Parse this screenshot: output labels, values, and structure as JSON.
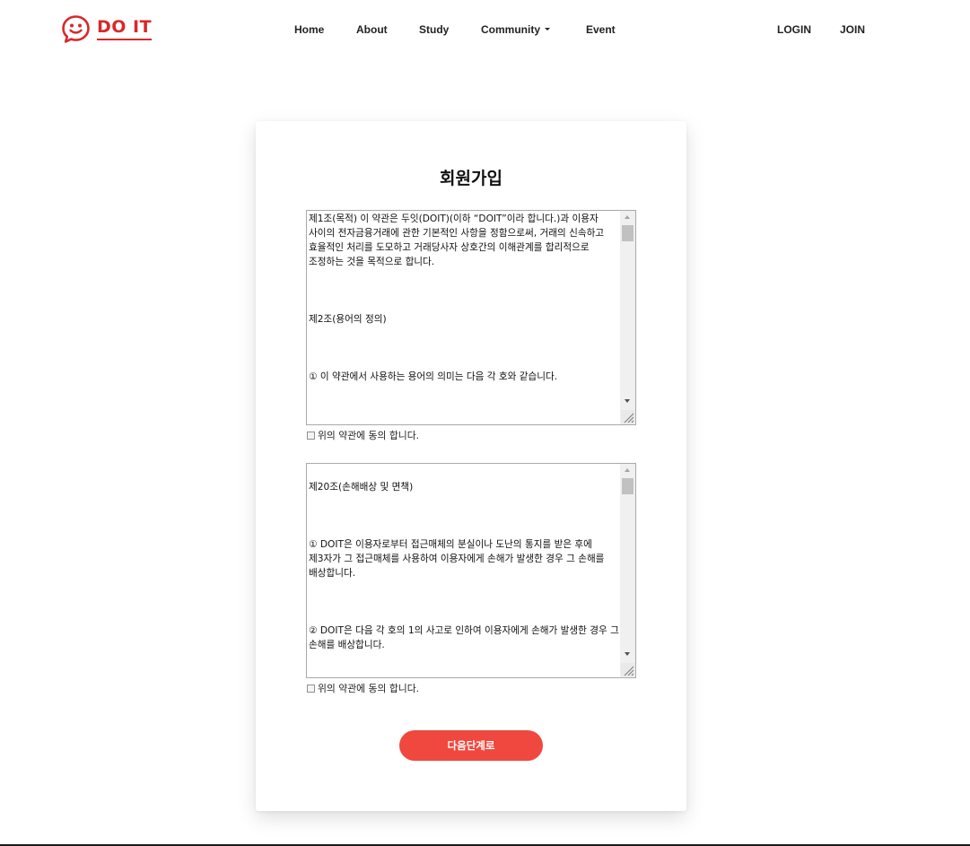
{
  "brand": {
    "name": "DO IT",
    "color": "#d8292b"
  },
  "nav": {
    "home": "Home",
    "about": "About",
    "study": "Study",
    "community": "Community",
    "event": "Event",
    "login": "LOGIN",
    "join": "JOIN"
  },
  "signup": {
    "title": "회원가입",
    "terms1": {
      "paragraphs": [
        "제1조(목적) 이 약관은 두잇(DOIT)(이하 “DOIT”이라 합니다.)과 이용자 사이의 전자금융거래에 관한 기본적인 사항을 정함으로써, 거래의 신속하고 효율적인 처리를 도모하고 거래당사자 상호간의 이해관계를 합리적으로 조정하는 것을 목적으로 합니다.",
        "제2조(용어의 정의)",
        "① 이 약관에서 사용하는 용어의 의미는 다음 각 호와 같습니다."
      ],
      "agree_label": "위의 약관에 동의 합니다."
    },
    "terms2": {
      "paragraphs": [
        "제20조(손해배상 및 면책)",
        "① DOIT은 이용자로부터 접근매체의 분실이나 도난의 통지를 받은 후에 제3자가 그 접근매체를 사용하여 이용자에게 손해가 발생한 경우 그 손해를 배상합니다.",
        "② DOIT은 다음 각 호의 1의 사고로 인하여 이용자에게 손해가 발생한 경우 그 손해를 배상합니다."
      ],
      "agree_label": "위의 약관에 동의 합니다."
    },
    "next_button": "다음단계로",
    "accent_color": "#f0483e"
  }
}
